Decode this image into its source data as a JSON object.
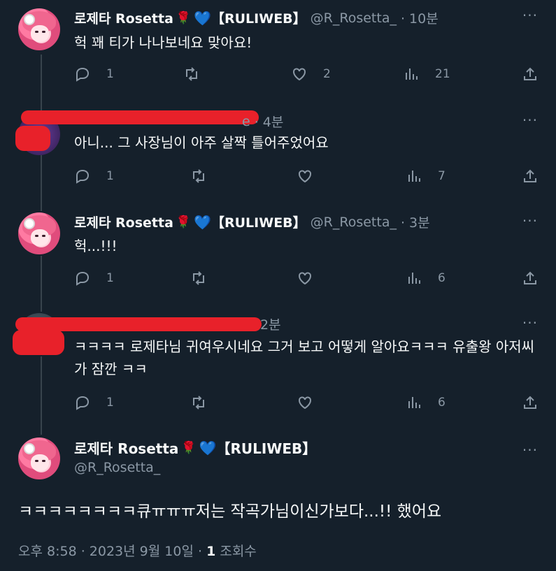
{
  "replies": [
    {
      "display_name": "로제타 Rosetta",
      "emoji": "🌹",
      "heart": "💙",
      "tag": "【RULIWEB】",
      "handle": "@R_Rosetta_",
      "time": "· 10분",
      "text": "헉 꽤 티가 나나보네요 맞아요!",
      "replies": "1",
      "retweets": "",
      "likes": "2",
      "views": "21"
    },
    {
      "visible_name_fragment": "e",
      "time": "· 4분",
      "text": "아니... 그 사장님이 아주 살짝 틀어주었어요",
      "replies": "1",
      "retweets": "",
      "likes": "",
      "views": "7"
    },
    {
      "display_name": "로제타 Rosetta",
      "emoji": "🌹",
      "heart": "💙",
      "tag": "【RULIWEB】",
      "handle": "@R_Rosetta_",
      "time": "· 3분",
      "text": "헉...!!!",
      "replies": "1",
      "retweets": "",
      "likes": "",
      "views": "6"
    },
    {
      "time": "2분",
      "text": "ㅋㅋㅋㅋ 로제타님 귀여우시네요 그거 보고 어떻게 알아요ㅋㅋㅋ 유출왕 아저씨가 잠깐 ㅋㅋ",
      "replies": "1",
      "retweets": "",
      "likes": "",
      "views": "6"
    }
  ],
  "main": {
    "display_name": "로제타 Rosetta",
    "emoji": "🌹",
    "heart": "💙",
    "tag": "【RULIWEB】",
    "handle": "@R_Rosetta_",
    "text": "ㅋㅋㅋㅋㅋㅋㅋㅋ큐ㅠㅠㅠ저는 작곡가님이신가보다...!! 했어요",
    "timestamp": "오후 8:58 · 2023년 9월 10일 ·",
    "views_count": "1",
    "views_label": "조회수"
  },
  "more_glyph": "···",
  "colors": {
    "bg": "#15202b",
    "text": "#f7f9f9",
    "muted": "#8b98a5",
    "line": "#38444d",
    "redaction": "#e8212a"
  }
}
